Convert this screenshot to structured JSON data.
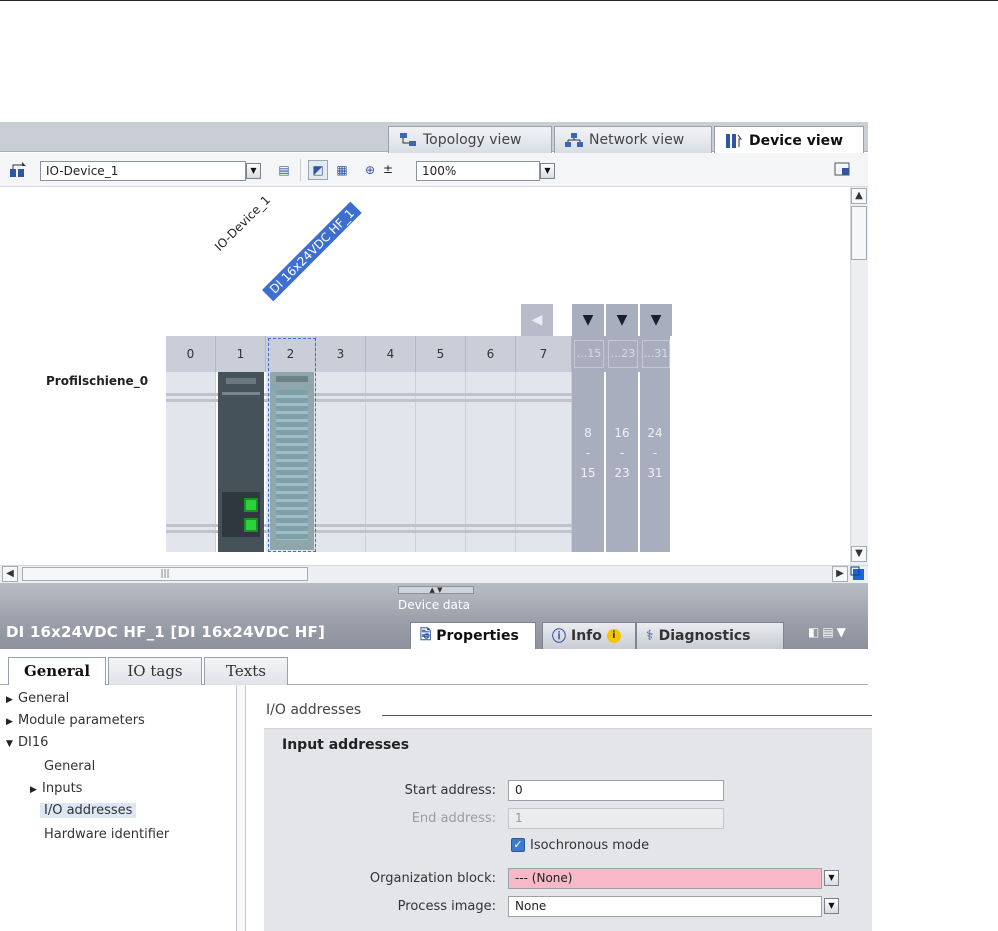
{
  "views": {
    "topology": "Topology view",
    "network": "Network view",
    "device": "Device view"
  },
  "toolbar": {
    "device_select": "IO-Device_1",
    "zoom": "100%"
  },
  "canvas": {
    "device_label": "IO-Device_1",
    "module_label": "DI 16x24VDC HF_1",
    "rail_label": "Profilschiene_0",
    "slots": [
      "0",
      "1",
      "2",
      "3",
      "4",
      "5",
      "6",
      "7"
    ],
    "expansion": [
      {
        "header": "...15",
        "from": "8",
        "sep": "-",
        "to": "15"
      },
      {
        "header": "...23",
        "from": "16",
        "sep": "-",
        "to": "23"
      },
      {
        "header": "...31",
        "from": "24",
        "sep": "-",
        "to": "31"
      }
    ],
    "hscroll_thumb_glyph": "|||"
  },
  "device_data": "Device data",
  "properties": {
    "title": "DI 16x24VDC HF_1 [DI 16x24VDC HF]",
    "tabs": {
      "properties": "Properties",
      "info": "Info",
      "info_badge": "i",
      "diagnostics": "Diagnostics"
    },
    "inner_tabs": [
      "General",
      "IO tags",
      "Texts"
    ],
    "tree": [
      {
        "label": "General",
        "arrow": "▶"
      },
      {
        "label": "Module parameters",
        "arrow": "▶"
      },
      {
        "label": "DI16",
        "arrow": "▼"
      },
      {
        "label": "General",
        "arrow": ""
      },
      {
        "label": "Inputs",
        "arrow": "▶"
      },
      {
        "label": "I/O addresses",
        "arrow": ""
      },
      {
        "label": "Hardware identifier",
        "arrow": ""
      }
    ],
    "section_title": "I/O addresses",
    "panel_title": "Input addresses",
    "fields": {
      "start_label": "Start address:",
      "start_value": "0",
      "end_label": "End address:",
      "end_value": "1",
      "iso_label": "Isochronous mode",
      "ob_label": "Organization block:",
      "ob_value": "--- (None)",
      "pi_label": "Process image:",
      "pi_value": "None"
    }
  },
  "colors": {
    "accent": "#3c6fd0",
    "error_field": "#f7b8c8",
    "header_gray": "#9ea3ad"
  }
}
